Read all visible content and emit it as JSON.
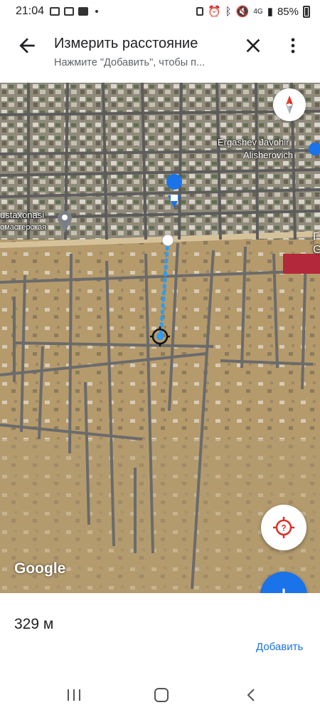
{
  "status_bar": {
    "time": "21:04",
    "network": "4G",
    "battery": "85%"
  },
  "header": {
    "title": "Измерить расстояние",
    "subtitle": "Нажмите \"Добавить\", чтобы п..."
  },
  "map": {
    "labels": {
      "place_right_line1": "Ergashev Javohir",
      "place_right_line2": "Alisherovich",
      "place_left_line1": "ustaxonasi",
      "place_left_line2": "омастерская",
      "edge_right_1": "Г",
      "edge_right_2": "G"
    },
    "logo": "Google",
    "measure_color": "#2a9df4"
  },
  "panel": {
    "distance": "329 м",
    "add_label": "Добавить"
  },
  "colors": {
    "accent": "#1a73e8",
    "locate_icon": "#d93025"
  }
}
